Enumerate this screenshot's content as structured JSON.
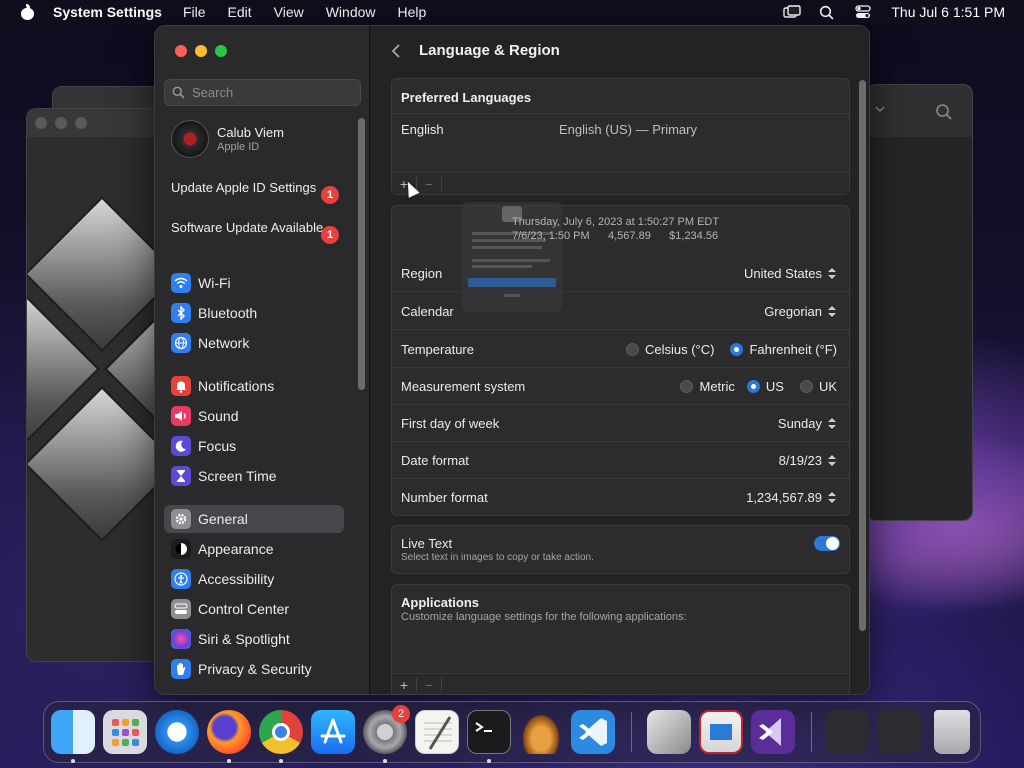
{
  "menubar": {
    "app_name": "System Settings",
    "menus": [
      "File",
      "Edit",
      "View",
      "Window",
      "Help"
    ],
    "clock": "Thu Jul 6  1:51 PM"
  },
  "sidebar": {
    "search_placeholder": "Search",
    "profile": {
      "name": "Calub Viem",
      "sub": "Apple ID"
    },
    "notices": [
      {
        "label": "Update Apple ID Settings",
        "badge": "1"
      },
      {
        "label": "Software Update Available",
        "badge": "1"
      }
    ],
    "items": [
      {
        "label": "Wi-Fi",
        "icon": "wifi-icon",
        "color": "#2f7ff0"
      },
      {
        "label": "Bluetooth",
        "icon": "bluetooth-icon",
        "color": "#2f7ff0"
      },
      {
        "label": "Network",
        "icon": "globe-icon",
        "color": "#2f7ff0"
      },
      {
        "label": "Notifications",
        "icon": "bell-icon",
        "color": "#e8403a"
      },
      {
        "label": "Sound",
        "icon": "speaker-icon",
        "color": "#e83a63"
      },
      {
        "label": "Focus",
        "icon": "moon-icon",
        "color": "#5a4bd6"
      },
      {
        "label": "Screen Time",
        "icon": "hourglass-icon",
        "color": "#5a4bd6"
      },
      {
        "label": "General",
        "icon": "gear-icon",
        "color": "#8e8e93"
      },
      {
        "label": "Appearance",
        "icon": "appearance-icon",
        "color": "#1c1c1e"
      },
      {
        "label": "Accessibility",
        "icon": "accessibility-icon",
        "color": "#2f7ff0"
      },
      {
        "label": "Control Center",
        "icon": "control-center-icon",
        "color": "#8e8e93"
      },
      {
        "label": "Siri & Spotlight",
        "icon": "siri-icon",
        "color": "#b23ab8"
      },
      {
        "label": "Privacy & Security",
        "icon": "hand-icon",
        "color": "#2f7ff0"
      }
    ],
    "active": "General"
  },
  "content": {
    "title": "Language & Region",
    "preferred_languages": {
      "header": "Preferred Languages",
      "rows": [
        {
          "name": "English",
          "detail": "English (US) — Primary"
        }
      ]
    },
    "format_preview": {
      "line1": "Thursday, July 6, 2023 at 1:50:27 PM EDT",
      "line2": "7/6/23, 1:50 PM      4,567.89      $1,234.56"
    },
    "region": {
      "label": "Region",
      "value": "United States"
    },
    "calendar": {
      "label": "Calendar",
      "value": "Gregorian"
    },
    "temperature": {
      "label": "Temperature",
      "options": [
        "Celsius (°C)",
        "Fahrenheit (°F)"
      ],
      "selected": "Fahrenheit (°F)"
    },
    "measurement": {
      "label": "Measurement system",
      "options": [
        "Metric",
        "US",
        "UK"
      ],
      "selected": "US"
    },
    "first_day": {
      "label": "First day of week",
      "value": "Sunday"
    },
    "date_format": {
      "label": "Date format",
      "value": "8/19/23"
    },
    "number_format": {
      "label": "Number format",
      "value": "1,234,567.89"
    },
    "live_text": {
      "title": "Live Text",
      "sub": "Select text in images to copy or take action.",
      "on": true
    },
    "applications": {
      "title": "Applications",
      "sub": "Customize language settings for the following applications:"
    },
    "plus": "+",
    "minus": "−"
  },
  "dock": {
    "apps": [
      {
        "name": "Finder",
        "icon": "finder-icon"
      },
      {
        "name": "Launchpad",
        "icon": "launchpad-icon"
      },
      {
        "name": "Safari",
        "icon": "safari-icon"
      },
      {
        "name": "Firefox",
        "icon": "firefox-icon"
      },
      {
        "name": "Chrome",
        "icon": "chrome-icon"
      },
      {
        "name": "App Store",
        "icon": "app-store-icon"
      },
      {
        "name": "System Settings",
        "icon": "system-settings-icon",
        "badge": "2"
      },
      {
        "name": "TextEdit",
        "icon": "textedit-icon"
      },
      {
        "name": "Terminal",
        "icon": "terminal-icon"
      },
      {
        "name": "GarageBand",
        "icon": "garageband-icon"
      },
      {
        "name": "Visual Studio Code",
        "icon": "vscode-icon"
      },
      {
        "name": "Boot Camp Assistant",
        "icon": "bootcamp-icon"
      },
      {
        "name": "Parallels",
        "icon": "parallels-icon"
      },
      {
        "name": "Visual Studio",
        "icon": "visual-studio-icon"
      },
      {
        "name": "Applications",
        "icon": "applications-folder-icon"
      },
      {
        "name": "Downloads",
        "icon": "downloads-folder-icon"
      },
      {
        "name": "Trash",
        "icon": "trash-icon"
      }
    ]
  }
}
